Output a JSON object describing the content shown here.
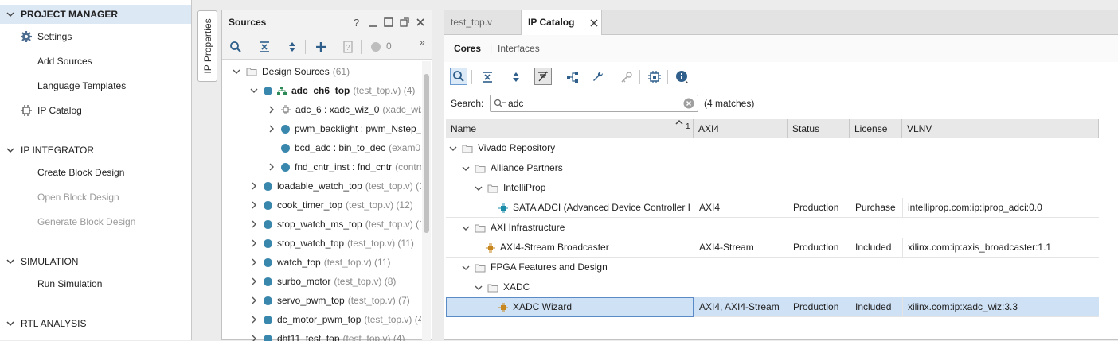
{
  "flow_navigator": {
    "sections": [
      {
        "title": "PROJECT MANAGER",
        "items": [
          "Settings",
          "Add Sources",
          "Language Templates",
          "IP Catalog"
        ]
      },
      {
        "title": "IP INTEGRATOR",
        "items": [
          "Create Block Design",
          "Open Block Design",
          "Generate Block Design"
        ]
      },
      {
        "title": "SIMULATION",
        "items": [
          "Run Simulation"
        ]
      },
      {
        "title": "RTL ANALYSIS",
        "items": []
      }
    ]
  },
  "ip_properties_tab": "IP Properties",
  "sources": {
    "title": "Sources",
    "badge_count": "0",
    "tree": [
      {
        "name": "Design Sources",
        "detail": "(61)"
      },
      {
        "name": "adc_ch6_top",
        "detail": "(test_top.v) (4)"
      },
      {
        "name": "adc_6 : xadc_wiz_0",
        "detail": "(xadc_wiz"
      },
      {
        "name": "pwm_backlight : pwm_Nstep_",
        "detail": ""
      },
      {
        "name": "bcd_adc : bin_to_dec",
        "detail": "(exam0"
      },
      {
        "name": "fnd_cntr_inst : fnd_cntr",
        "detail": "(contro"
      },
      {
        "name": "loadable_watch_top",
        "detail": "(test_top.v) (1"
      },
      {
        "name": "cook_timer_top",
        "detail": "(test_top.v) (12)"
      },
      {
        "name": "stop_watch_ms_top",
        "detail": "(test_top.v) (1"
      },
      {
        "name": "stop_watch_top",
        "detail": "(test_top.v) (11)"
      },
      {
        "name": "watch_top",
        "detail": "(test_top.v) (11)"
      },
      {
        "name": "surbo_motor",
        "detail": "(test_top.v) (8)"
      },
      {
        "name": "servo_pwm_top",
        "detail": "(test_top.v) (7)"
      },
      {
        "name": "dc_motor_pwm_top",
        "detail": "(test_top.v) (4"
      },
      {
        "name": "dht11_test_top",
        "detail": "(test_top.v) (4)"
      }
    ]
  },
  "catalog": {
    "tabs": [
      {
        "label": "test_top.v",
        "active": false
      },
      {
        "label": "IP Catalog",
        "active": true
      }
    ],
    "subtabs": {
      "cores": "Cores",
      "separator": "|",
      "interfaces": "Interfaces"
    },
    "search": {
      "label": "Search:",
      "value": "adc",
      "matches": "(4 matches)"
    },
    "columns": [
      "Name",
      "AXI4",
      "Status",
      "License",
      "VLNV"
    ],
    "sort_indicator": "1",
    "rows": [
      {
        "name": "Vivado Repository",
        "axi4": "",
        "status": "",
        "license": "",
        "vlnv": ""
      },
      {
        "name": "Alliance Partners",
        "axi4": "",
        "status": "",
        "license": "",
        "vlnv": ""
      },
      {
        "name": "IntelliProp",
        "axi4": "",
        "status": "",
        "license": "",
        "vlnv": ""
      },
      {
        "name": "SATA ADCI (Advanced Device Controller I",
        "axi4": "AXI4",
        "status": "Production",
        "license": "Purchase",
        "vlnv": "intelliprop.com:ip:iprop_adci:0.0"
      },
      {
        "name": "AXI Infrastructure",
        "axi4": "",
        "status": "",
        "license": "",
        "vlnv": ""
      },
      {
        "name": "AXI4-Stream Broadcaster",
        "axi4": "AXI4-Stream",
        "status": "Production",
        "license": "Included",
        "vlnv": "xilinx.com:ip:axis_broadcaster:1.1"
      },
      {
        "name": "FPGA Features and Design",
        "axi4": "",
        "status": "",
        "license": "",
        "vlnv": ""
      },
      {
        "name": "XADC",
        "axi4": "",
        "status": "",
        "license": "",
        "vlnv": ""
      },
      {
        "name": "XADC Wizard",
        "axi4": "AXI4, AXI4-Stream",
        "status": "Production",
        "license": "Included",
        "vlnv": "xilinx.com:ip:xadc_wiz:3.3"
      }
    ]
  },
  "colors": {
    "accent": "#3a87ad",
    "selection": "#cfe1f5",
    "header": "#e8e8e8",
    "ip_icon": "#c8861e"
  }
}
